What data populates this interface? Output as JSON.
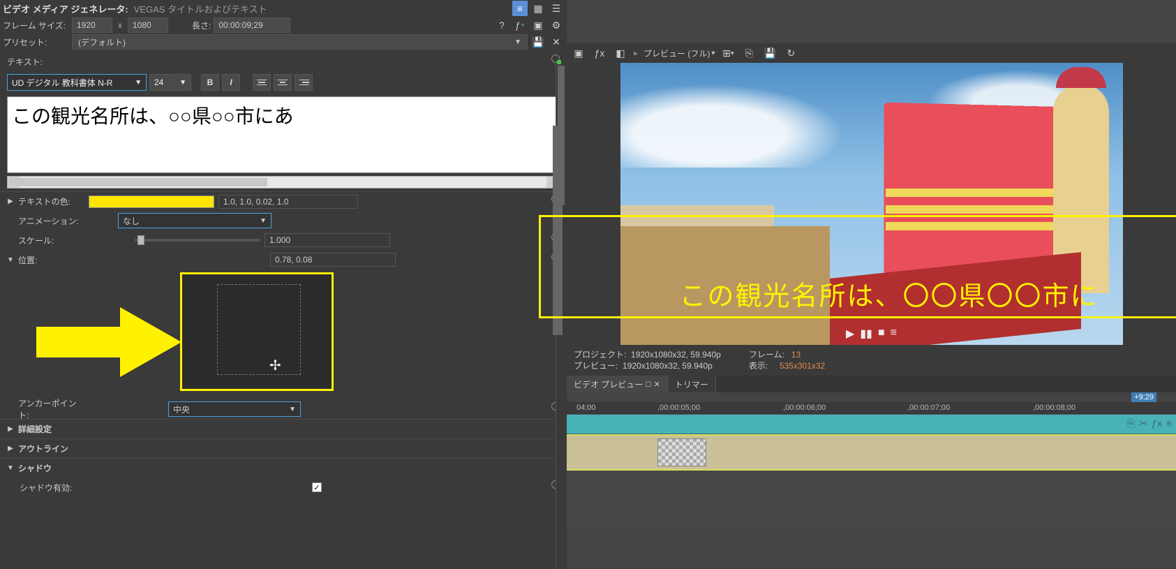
{
  "header": {
    "title": "ビデオ メディア ジェネレータ:",
    "subtitle": "VEGAS タイトルおよびテキスト",
    "frame_size_label": "フレーム サイズ:",
    "width": "1920",
    "x": "x",
    "height": "1080",
    "length_label": "長さ:",
    "length_value": "00:00:09;29",
    "preset_label": "プリセット:",
    "preset_value": "(デフォルト)"
  },
  "text_section": {
    "label": "テキスト:",
    "font": "UD デジタル 教科書体 N-R",
    "size": "24",
    "bold": "B",
    "italic": "I",
    "content": "この観光名所は、○○県○○市にあ"
  },
  "props": {
    "text_color_label": "テキストの色:",
    "text_color_hex": "#ffe600",
    "text_color_rgba": "1.0, 1.0, 0.02, 1.0",
    "animation_label": "アニメーション:",
    "animation_value": "なし",
    "scale_label": "スケール:",
    "scale_value": "1.000",
    "position_label": "位置:",
    "position_value": "0.78, 0.08",
    "anchor_label": "アンカーポイント:",
    "anchor_value": "中央",
    "advanced_label": "詳細設定",
    "outline_label": "アウトライン",
    "shadow_label": "シャドウ",
    "shadow_enable_label": "シャドウ有効:"
  },
  "preview": {
    "toolbar_preview": "プレビュー (フル)",
    "subtitle": "この観光名所は、〇〇県〇〇市に",
    "info": {
      "project_label": "プロジェクト:",
      "project_value": "1920x1080x32, 59.940p",
      "preview_label": "プレビュー:",
      "preview_value": "1920x1080x32, 59.940p",
      "frame_label": "フレーム:",
      "frame_value": "13",
      "display_label": "表示:",
      "display_value": "535x301x32"
    },
    "tabs": {
      "video_preview": "ビデオ プレビュー",
      "trimmer": "トリマー",
      "pin": "□",
      "close": "✕"
    },
    "ruler_marker": "+9;29"
  },
  "timeline": {
    "ticks": [
      "04;00",
      ",00:00:05;00",
      ",00:00:06;00",
      ",00:00:07;00",
      ",00:00:08;00"
    ]
  }
}
